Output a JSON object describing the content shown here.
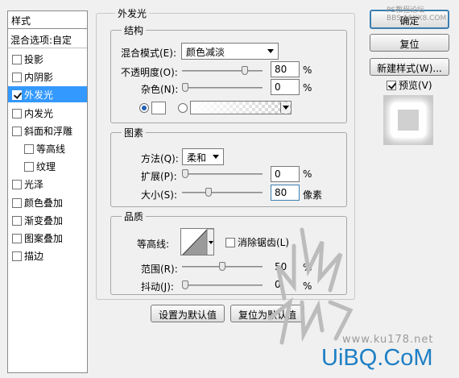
{
  "watermark_top": "PS教程论坛\nBBS.16XX8.COM",
  "watermark_site": "www.ku178.net",
  "watermark_brand": "UiBQ.CoM",
  "style_list": {
    "header": "样式",
    "blend_options": "混合选项:自定",
    "items": [
      {
        "label": "投影",
        "checked": false,
        "selected": false,
        "sub": false
      },
      {
        "label": "内阴影",
        "checked": false,
        "selected": false,
        "sub": false
      },
      {
        "label": "外发光",
        "checked": true,
        "selected": true,
        "sub": false
      },
      {
        "label": "内发光",
        "checked": false,
        "selected": false,
        "sub": false
      },
      {
        "label": "斜面和浮雕",
        "checked": false,
        "selected": false,
        "sub": false
      },
      {
        "label": "等高线",
        "checked": false,
        "selected": false,
        "sub": true
      },
      {
        "label": "纹理",
        "checked": false,
        "selected": false,
        "sub": true
      },
      {
        "label": "光泽",
        "checked": false,
        "selected": false,
        "sub": false
      },
      {
        "label": "颜色叠加",
        "checked": false,
        "selected": false,
        "sub": false
      },
      {
        "label": "渐变叠加",
        "checked": false,
        "selected": false,
        "sub": false
      },
      {
        "label": "图案叠加",
        "checked": false,
        "selected": false,
        "sub": false
      },
      {
        "label": "描边",
        "checked": false,
        "selected": false,
        "sub": false
      }
    ]
  },
  "panel": {
    "title": "外发光",
    "structure": {
      "title": "结构",
      "blend_mode_label": "混合模式(E):",
      "blend_mode_value": "颜色减淡",
      "opacity_label": "不透明度(O):",
      "opacity_value": "80",
      "opacity_level": 0.8,
      "noise_label": "杂色(N):",
      "noise_value": "0",
      "noise_level": 0,
      "pct": "%"
    },
    "elements": {
      "title": "图素",
      "technique_label": "方法(Q):",
      "technique_value": "柔和",
      "spread_label": "扩展(P):",
      "spread_value": "0",
      "spread_level": 0,
      "size_label": "大小(S):",
      "size_value": "80",
      "size_level": 0.32,
      "pct": "%",
      "size_unit": "像素"
    },
    "quality": {
      "title": "品质",
      "contour_label": "等高线:",
      "antialias_label": "消除锯齿(L)",
      "range_label": "范围(R):",
      "range_value": "50",
      "range_level": 0.5,
      "jitter_label": "抖动(J):",
      "jitter_value": "0",
      "jitter_level": 0,
      "pct": "%"
    },
    "make_default": "设置为默认值",
    "reset_default": "复位为默认值"
  },
  "actions": {
    "ok": "确定",
    "reset": "复位",
    "new_style": "新建样式(W)...",
    "preview_label": "预览(V)",
    "preview_checked": true
  }
}
